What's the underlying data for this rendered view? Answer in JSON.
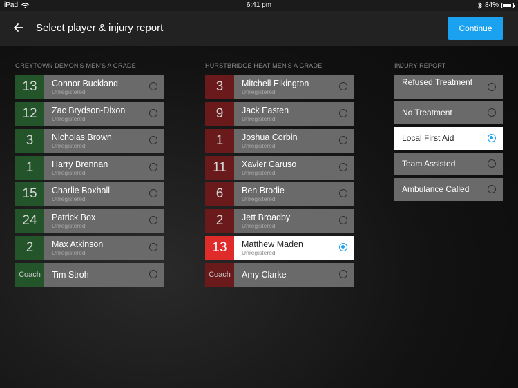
{
  "status_bar": {
    "device": "iPad",
    "time": "6:41 pm",
    "battery": "84%",
    "battery_level": 0.84,
    "wifi_icon": "wifi-icon",
    "bluetooth_icon": "bluetooth-icon"
  },
  "header": {
    "title": "Select player & injury report",
    "continue_label": "Continue",
    "back_icon": "back-arrow-icon"
  },
  "colors": {
    "accent": "#1aa1f0",
    "home_number": "#24552a",
    "away_number": "#6a1a1a",
    "selected_number": "#e02b2b"
  },
  "home_team": {
    "title": "GREYTOWN DEMON'S MEN'S A GRADE",
    "players": [
      {
        "number": "13",
        "name": "Connor Buckland",
        "status": "Unregistered"
      },
      {
        "number": "12",
        "name": "Zac Brydson-Dixon",
        "status": "Unregistered"
      },
      {
        "number": "3",
        "name": "Nicholas Brown",
        "status": "Unregistered"
      },
      {
        "number": "1",
        "name": "Harry Brennan",
        "status": "Unregistered"
      },
      {
        "number": "15",
        "name": "Charlie Boxhall",
        "status": "Unregistered"
      },
      {
        "number": "24",
        "name": "Patrick Box",
        "status": "Unregistered"
      },
      {
        "number": "2",
        "name": "Max Atkinson",
        "status": "Unregistered"
      }
    ],
    "coach": {
      "number": "Coach",
      "name": "Tim Stroh"
    }
  },
  "away_team": {
    "title": "HURSTBRIDGE HEAT MEN'S A GRADE",
    "players": [
      {
        "number": "3",
        "name": "Mitchell Elkington",
        "status": "Unregistered"
      },
      {
        "number": "9",
        "name": "Jack Easten",
        "status": "Unregistered"
      },
      {
        "number": "1",
        "name": "Joshua Corbin",
        "status": "Unregistered"
      },
      {
        "number": "11",
        "name": "Xavier Caruso",
        "status": "Unregistered"
      },
      {
        "number": "6",
        "name": "Ben Brodie",
        "status": "Unregistered"
      },
      {
        "number": "2",
        "name": "Jett Broadby",
        "status": "Unregistered"
      },
      {
        "number": "13",
        "name": "Matthew Maden",
        "status": "Unregistered"
      }
    ],
    "coach": {
      "number": "Coach",
      "name": "Amy Clarke"
    },
    "selected_index": 6
  },
  "injury_report": {
    "title": "INJURY REPORT",
    "options": [
      "Refused Treatment",
      "No Treatment",
      "Local First Aid",
      "Team Assisted",
      "Ambulance Called"
    ],
    "selected_index": 2
  }
}
